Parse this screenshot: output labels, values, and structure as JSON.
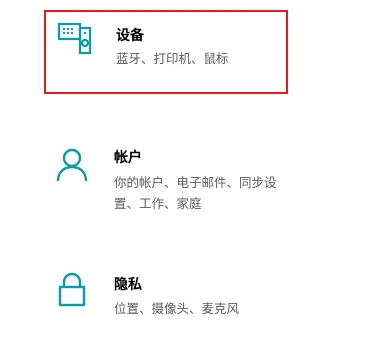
{
  "settings": {
    "tiles": [
      {
        "title": "设备",
        "description": "蓝牙、打印机、鼠标",
        "icon": "devices-icon",
        "highlight_color": "#e21b1b"
      },
      {
        "title": "帐户",
        "description": "你的帐户、电子邮件、同步设置、工作、家庭",
        "icon": "person-icon"
      },
      {
        "title": "隐私",
        "description": "位置、摄像头、麦克风",
        "icon": "lock-icon"
      }
    ],
    "accent_color": "#0a9baa"
  }
}
